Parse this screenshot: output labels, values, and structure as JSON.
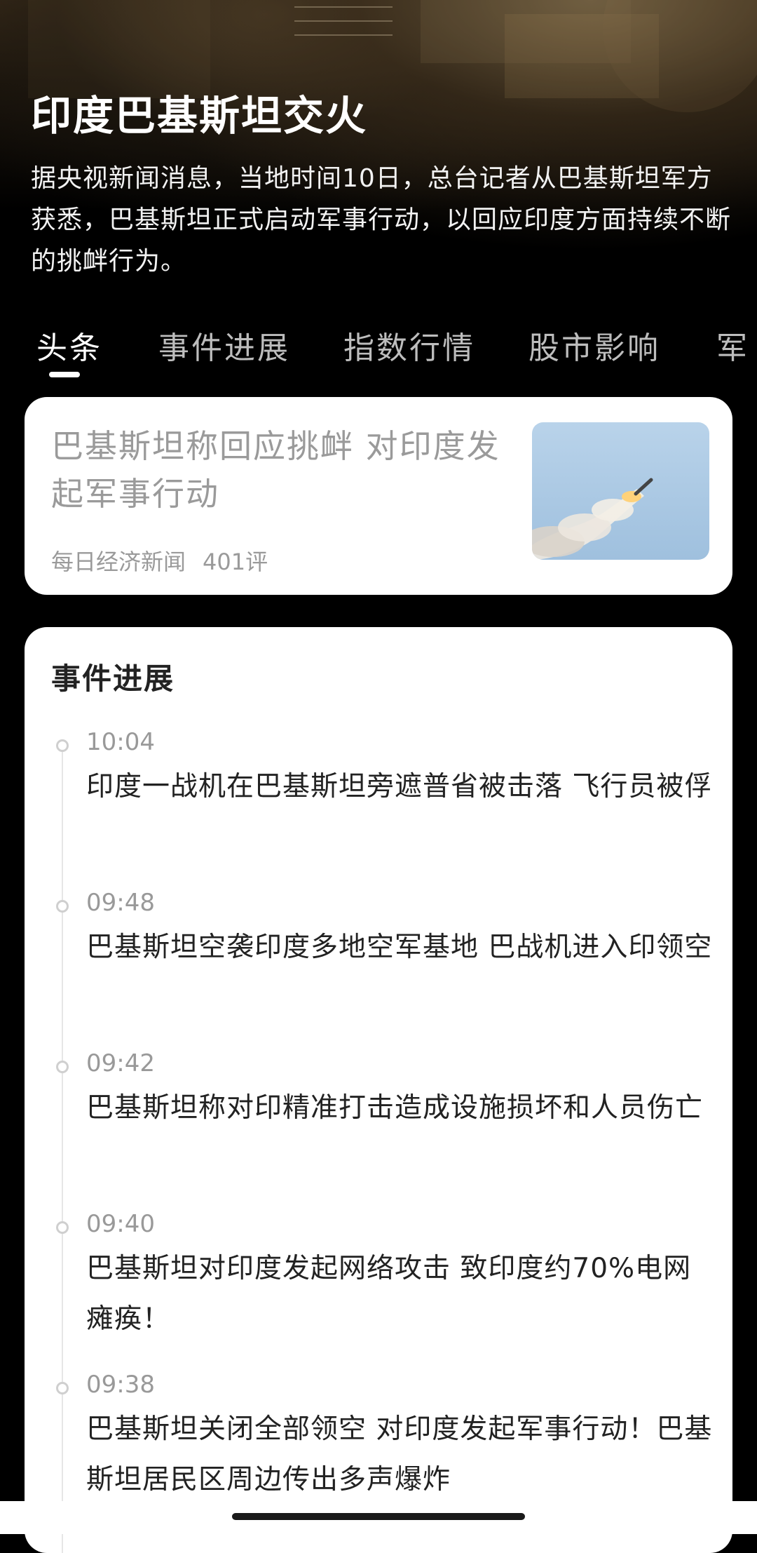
{
  "topic": {
    "title": "印度巴基斯坦交火",
    "description": "据央视新闻消息，当地时间10日，总台记者从巴基斯坦军方获悉，巴基斯坦正式启动军事行动，以回应印度方面持续不断的挑衅行为。"
  },
  "tabs": [
    {
      "label": "头条",
      "active": true
    },
    {
      "label": "事件进展",
      "active": false
    },
    {
      "label": "指数行情",
      "active": false
    },
    {
      "label": "股市影响",
      "active": false
    },
    {
      "label": "军",
      "active": false
    }
  ],
  "headline": {
    "title": "巴基斯坦称回应挑衅 对印度发起军事行动",
    "source": "每日经济新闻",
    "comments": "401评",
    "thumbnail_icon": "missile-launch-image"
  },
  "progress": {
    "title": "事件进展",
    "items": [
      {
        "time": "10:04",
        "text": "印度一战机在巴基斯坦旁遮普省被击落 飞行员被俘"
      },
      {
        "time": "09:48",
        "text": "巴基斯坦空袭印度多地空军基地 巴战机进入印领空"
      },
      {
        "time": "09:42",
        "text": "巴基斯坦称对印精准打击造成设施损坏和人员伤亡"
      },
      {
        "time": "09:40",
        "text": "巴基斯坦对印度发起网络攻击 致印度约70%电网瘫痪！"
      },
      {
        "time": "09:38",
        "text": "巴基斯坦关闭全部领空 对印度发起军事行动！巴基斯坦居民区周边传出多声爆炸"
      }
    ]
  },
  "colors": {
    "background": "#000000",
    "card": "#ffffff",
    "muted_text": "#9a9a9a",
    "body_text": "#222222"
  }
}
